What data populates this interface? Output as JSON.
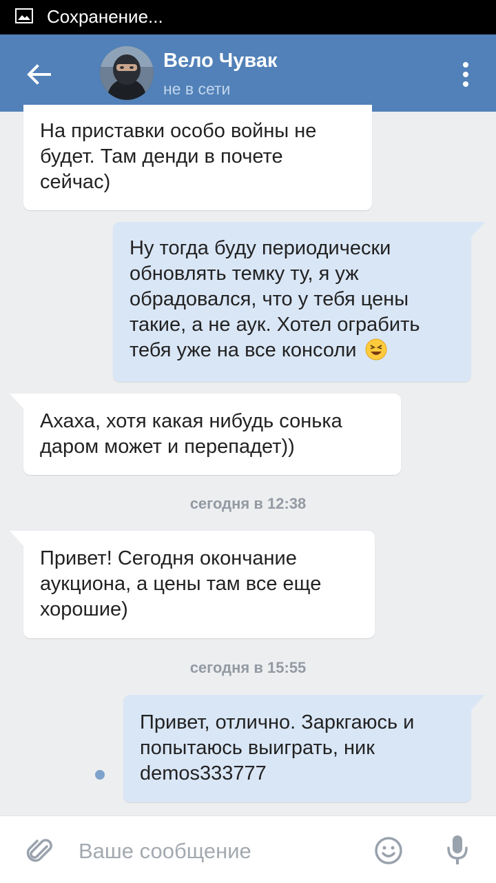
{
  "status_bar": {
    "text": "Сохранение..."
  },
  "header": {
    "name": "Вело Чувак",
    "status": "не в сети"
  },
  "messages": [
    {
      "dir": "in",
      "text": "На приставки особо войны не будет. Там денди в почете сейчас)"
    },
    {
      "dir": "out",
      "text": "Ну тогда буду периодически обновлять темку ту, я уж обрадовался, что у тебя цены такие, а не аук. Хотел ограбить тебя уже на все консоли"
    },
    {
      "dir": "in",
      "text": "Ахаха, хотя какая нибудь сонька даром может и перепадет))"
    },
    {
      "dir": "in",
      "text": "Привет! Сегодня окончание аукциона, а цены там все еще хорошие)"
    },
    {
      "dir": "out",
      "text": "Привет, отлично. Заркгаюсь и попытаюсь выиграть, ник demos333777"
    }
  ],
  "time_separators": [
    "сегодня в 12:38",
    "сегодня в 15:55"
  ],
  "composer": {
    "placeholder": "Ваше сообщение"
  },
  "colors": {
    "header": "#5181b8",
    "outgoing": "#d9e6f6",
    "incoming": "#ffffff",
    "background": "#edeef0"
  },
  "icons": [
    "image-icon",
    "back-arrow-icon",
    "more-vert-icon",
    "laughing-emoji-icon",
    "paperclip-icon",
    "smile-icon",
    "mic-icon"
  ]
}
